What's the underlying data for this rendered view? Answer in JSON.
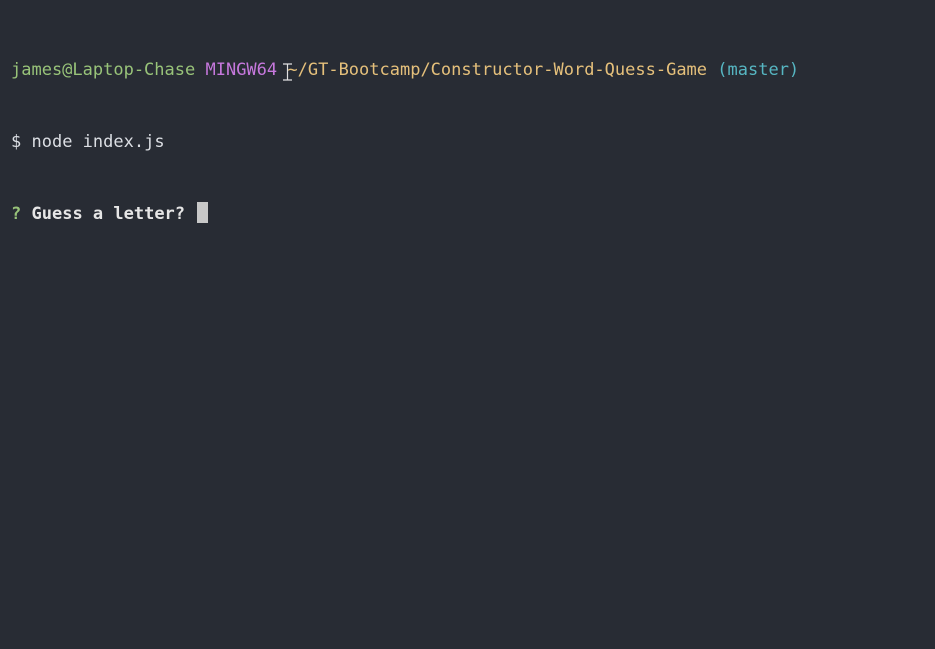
{
  "prompt_line": {
    "user_host": "james@Laptop-Chase",
    "system": "MINGW64",
    "path": "~/GT-Bootcamp/Constructor-Word-Quess-Game",
    "branch": "(master)"
  },
  "command_line": {
    "symbol": "$",
    "command": "node index.js"
  },
  "question_line": {
    "marker": "?",
    "text": "Guess a letter?"
  },
  "colors": {
    "background": "#282c34",
    "user_host": "#98c379",
    "system": "#c678dd",
    "path": "#e5c07b",
    "branch": "#56b6c2",
    "text": "#dcdfe4"
  },
  "icons": {
    "mouse_pointer": "text-cursor-ibeam-icon",
    "caret": "block-cursor-icon"
  }
}
